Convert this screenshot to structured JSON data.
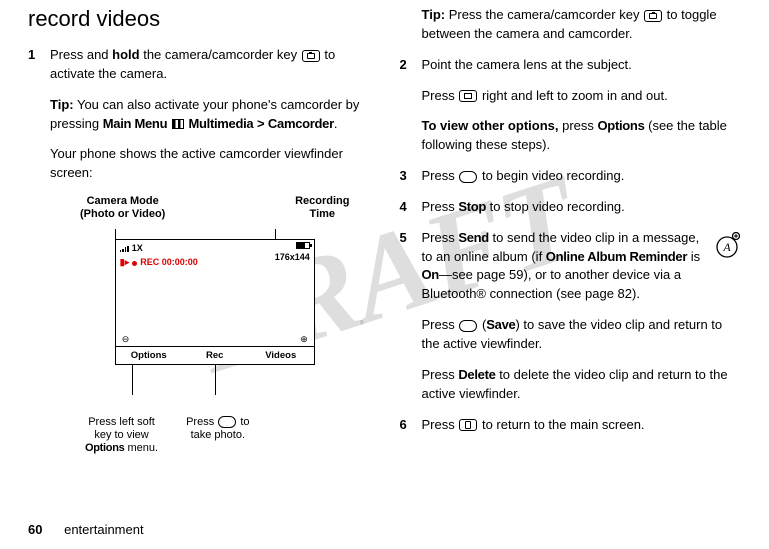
{
  "watermark": "DRAFT",
  "page_number": "60",
  "section_footer": "entertainment",
  "left": {
    "heading": "record videos",
    "step1": {
      "num": "1",
      "pre": "Press and ",
      "hold": "hold",
      "post1": " the camera/camcorder key ",
      "post2": " to activate the camera.",
      "tip_label": "Tip:",
      "tip_text": " You can also activate your phone's camcorder by pressing ",
      "menu_main": "Main Menu",
      "menu_multimedia": "Multimedia",
      "gt": ">",
      "menu_camcorder": "Camcorder",
      "period": ".",
      "vf_intro": "Your phone shows the active camcorder viewfinder screen:"
    },
    "figure": {
      "label_camera_mode_l1": "Camera Mode",
      "label_camera_mode_l2": "(Photo or Video)",
      "label_rec_time_l1": "Recording",
      "label_rec_time_l2": "Time",
      "zoom": "1X",
      "rec": "REC 00:00:00",
      "res": "176x144",
      "mag_minus": "⊖",
      "mag_plus": "⊕",
      "softkey_left": "Options",
      "softkey_center": "Rec",
      "softkey_right": "Videos",
      "bottom_left_l1": "Press left soft",
      "bottom_left_l2": "key to view",
      "bottom_left_l3": "Options",
      "bottom_left_l4": " menu.",
      "bottom_right_l1": "Press ",
      "bottom_right_l2": " to",
      "bottom_right_l3": "take photo."
    }
  },
  "right": {
    "tip_label": "Tip:",
    "tip_text1": " Press the camera/camcorder key ",
    "tip_text2": " to toggle between the camera and camcorder.",
    "step2": {
      "num": "2",
      "l1": "Point the camera lens at the subject.",
      "l2a": "Press ",
      "l2b": " right and left to zoom in and out.",
      "l3a": "To view other options,",
      "l3b": " press ",
      "l3c": "Options",
      "l3d": " (see the table following these steps)."
    },
    "step3": {
      "num": "3",
      "a": "Press ",
      "b": " to begin video recording."
    },
    "step4": {
      "num": "4",
      "a": "Press ",
      "stop": "Stop",
      "b": " to stop video recording."
    },
    "step5": {
      "num": "5",
      "a": "Press ",
      "send": "Send",
      "b": " to send the video clip in a message, to an online album (if ",
      "oar": "Online Album Reminder",
      "c": " is ",
      "on": "On",
      "d": "—see page 59), or to another device via a Bluetooth® connection (see page 82).",
      "p2a": "Press ",
      "p2b": " (",
      "save": "Save",
      "p2c": ") to save the video clip and return to the active viewfinder.",
      "p3a": "Press ",
      "del": "Delete",
      "p3b": " to delete the video clip and return to the active viewfinder."
    },
    "step6": {
      "num": "6",
      "a": "Press ",
      "b": " to return to the main screen."
    }
  }
}
